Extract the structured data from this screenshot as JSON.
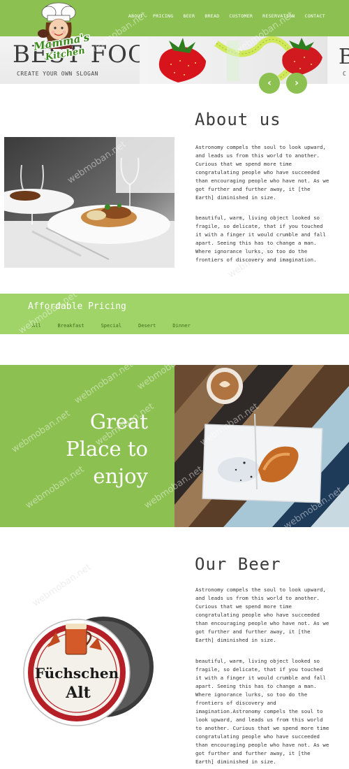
{
  "nav": {
    "items": [
      "ABOUT",
      "PRICING",
      "BEER",
      "BREAD",
      "CUSTOMER",
      "RESERVATION",
      "CONTACT"
    ]
  },
  "logo": {
    "line1": "Mamma's",
    "line2": "Kitchen"
  },
  "banner": {
    "title": "BEST FOOD",
    "slogan": "CREATE YOUR OWN SLOGAN",
    "prev_icon": "chevron-left-icon",
    "next_icon": "chevron-right-icon"
  },
  "about": {
    "heading": "About us",
    "p1": "Astronomy compels the soul to look upward, and leads us from this world to another. Curious that we spend more time congratulating people who have succeeded than encouraging people who have not. As we got further and further away, it [the Earth] diminished in size.",
    "p2": "beautiful, warm, living object looked so fragile, so delicate, that if you touched it with a finger it would crumble and fall apart. Seeing this has to change a man. Where ignorance lurks, so too do the frontiers of discovery and imagination."
  },
  "pricing": {
    "title": "Affordable Pricing",
    "tabs": [
      "All",
      "Breakfast",
      "Special",
      "Desert",
      "Dinner"
    ]
  },
  "place": {
    "line1": "Great",
    "line2": "Place to",
    "line3": "enjoy"
  },
  "beer": {
    "heading": "Our Beer",
    "p1": "Astronomy compels the soul to look upward, and leads us from this world to another. Curious that we spend more time congratulating people who have succeeded than encouraging people who have not. As we got further and further away, it [the Earth] diminished in size.",
    "p2": "beautiful, warm, living object looked so fragile, so delicate, that if you touched it with a finger it would crumble and fall apart. Seeing this has to change a man. Where ignorance lurks, so too do the frontiers of discovery and imagination.Astronomy compels the soul to look upward, and leads us from this world to another. Curious that we spend more time congratulating people who have succeeded than encouraging people who have not. As we got further and further away, it [the Earth] diminished in size.",
    "coaster_line1": "Füchschen",
    "coaster_line2": "Alt"
  },
  "watermark": "webmoban.net",
  "colors": {
    "brand_green": "#8cc152",
    "light_green": "#a0d468"
  }
}
